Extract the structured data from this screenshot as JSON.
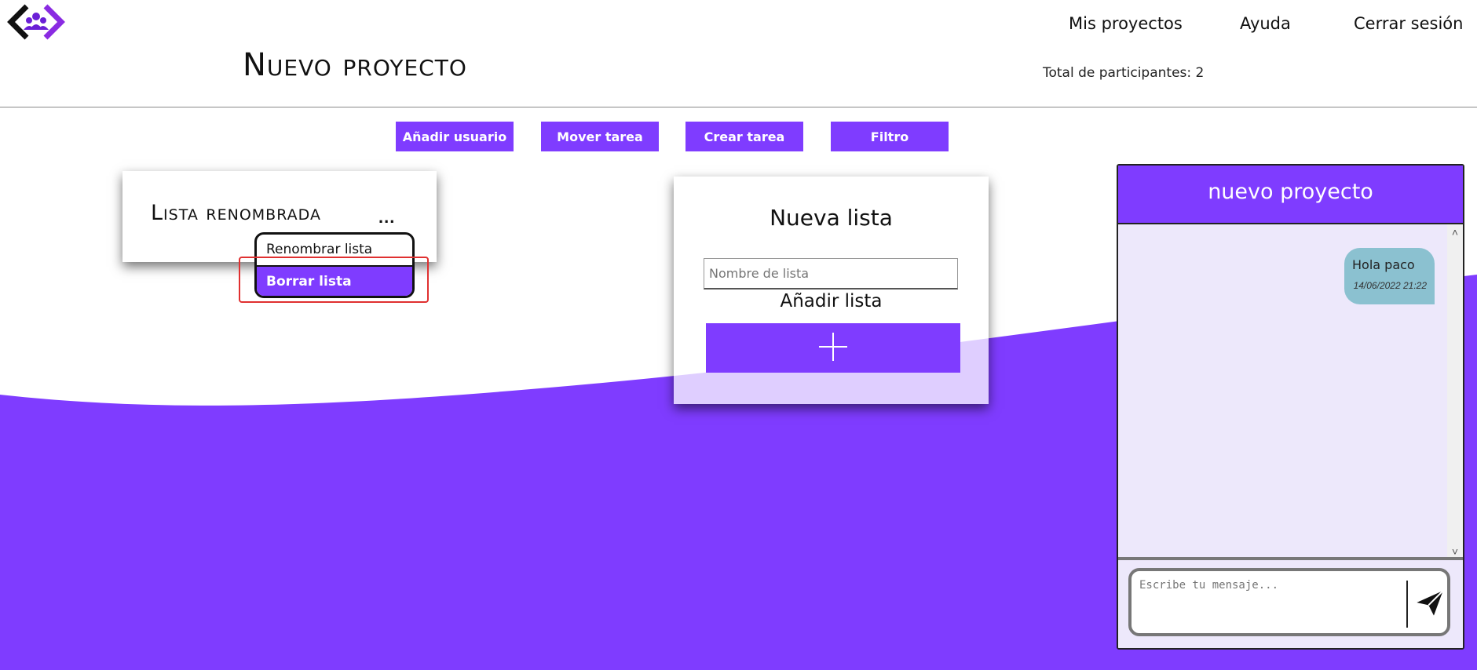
{
  "nav": {
    "my_projects": "Mis proyectos",
    "help": "Ayuda",
    "logout": "Cerrar sesión"
  },
  "page": {
    "title": "Nuevo proyecto",
    "participants": "Total de participantes: 2"
  },
  "toolbar": {
    "add_user": "Añadir usuario",
    "move_task": "Mover tarea",
    "create_task": "Crear tarea",
    "filter": "Filtro"
  },
  "list": {
    "title": "Lista renombrada",
    "more": "...",
    "menu": {
      "rename": "Renombrar lista",
      "delete": "Borrar lista"
    }
  },
  "new_list": {
    "title": "Nueva lista",
    "input_placeholder": "Nombre de lista",
    "add_label": "Añadir lista"
  },
  "chat": {
    "title": "nuevo proyecto",
    "messages": [
      {
        "text": "Hola paco",
        "time": "14/06/2022 21:22"
      }
    ],
    "input_placeholder": "Escribe tu mensaje..."
  },
  "icons": {
    "logo": "team-logo-icon",
    "add": "plus-icon",
    "send": "send-icon",
    "scroll_up": "chevron-up-icon",
    "scroll_down": "chevron-down-icon"
  },
  "colors": {
    "accent": "#7f3cff",
    "chat_bg": "#ede8fb",
    "bubble": "#8bc1d0",
    "highlight": "#e03030"
  }
}
